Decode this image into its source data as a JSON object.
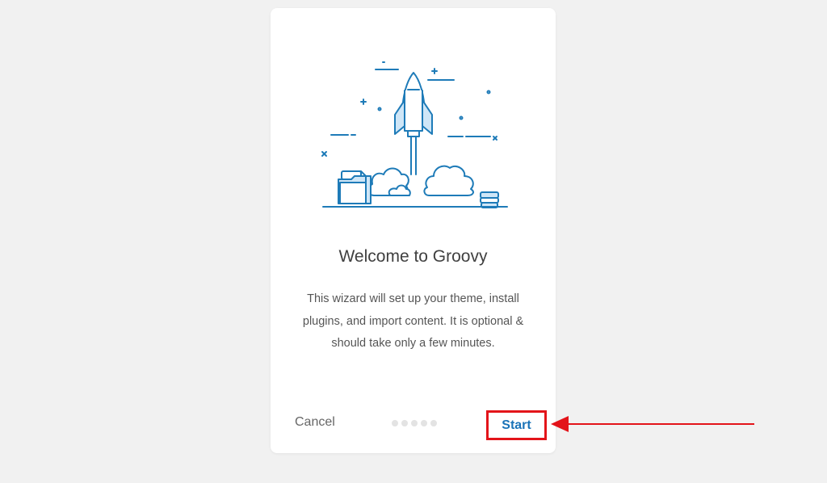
{
  "wizard": {
    "title": "Welcome to Groovy",
    "description": "This wizard will set up your theme, install plugins, and import content. It is optional & should take only a few minutes.",
    "cancel_label": "Cancel",
    "start_label": "Start",
    "steps_total": 5,
    "current_step": 1
  },
  "colors": {
    "page_bg": "#f1f1f1",
    "card_bg": "#ffffff",
    "illustration_blue": "#1e7bb8",
    "start_text": "#1a73b8",
    "highlight_red": "#e3141a"
  },
  "icons": {
    "hero": "rocket-launch-illustration",
    "annotation": "arrow-left-icon"
  }
}
